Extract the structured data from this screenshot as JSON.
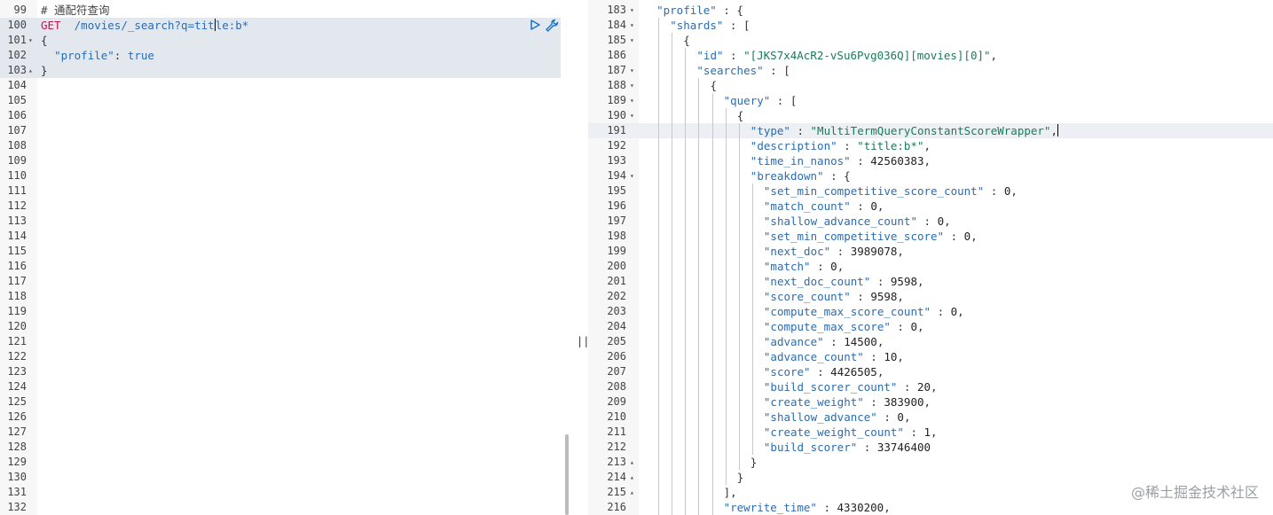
{
  "left_editor": {
    "lines": [
      {
        "no": "99",
        "fold": "",
        "tokens": [
          [
            "c",
            "# 通配符查询"
          ]
        ]
      },
      {
        "no": "100",
        "fold": "",
        "hl": "req",
        "tokens": [
          [
            "m",
            "GET"
          ],
          [
            "p",
            "  "
          ],
          [
            "u",
            "/movies/_search?q=tit"
          ],
          [
            "caret",
            ""
          ],
          [
            "u",
            "le:b*"
          ]
        ]
      },
      {
        "no": "101",
        "fold": "▾",
        "hl": "req",
        "tokens": [
          [
            "p",
            "{"
          ]
        ]
      },
      {
        "no": "102",
        "fold": "",
        "hl": "req",
        "tokens": [
          [
            "p",
            "  "
          ],
          [
            "k",
            "\"profile\""
          ],
          [
            "p",
            ": "
          ],
          [
            "b",
            "true"
          ]
        ]
      },
      {
        "no": "103",
        "fold": "▴",
        "hl": "req",
        "tokens": [
          [
            "p",
            "}"
          ]
        ]
      },
      {
        "no": "104",
        "fold": "",
        "tokens": []
      },
      {
        "no": "105",
        "fold": "",
        "tokens": []
      },
      {
        "no": "106",
        "fold": "",
        "tokens": []
      },
      {
        "no": "107",
        "fold": "",
        "tokens": []
      },
      {
        "no": "108",
        "fold": "",
        "tokens": []
      },
      {
        "no": "109",
        "fold": "",
        "tokens": []
      },
      {
        "no": "110",
        "fold": "",
        "tokens": []
      },
      {
        "no": "111",
        "fold": "",
        "tokens": []
      },
      {
        "no": "112",
        "fold": "",
        "tokens": []
      },
      {
        "no": "113",
        "fold": "",
        "tokens": []
      },
      {
        "no": "114",
        "fold": "",
        "tokens": []
      },
      {
        "no": "115",
        "fold": "",
        "tokens": []
      },
      {
        "no": "116",
        "fold": "",
        "tokens": []
      },
      {
        "no": "117",
        "fold": "",
        "tokens": []
      },
      {
        "no": "118",
        "fold": "",
        "tokens": []
      },
      {
        "no": "119",
        "fold": "",
        "tokens": []
      },
      {
        "no": "120",
        "fold": "",
        "tokens": []
      },
      {
        "no": "121",
        "fold": "",
        "tokens": []
      },
      {
        "no": "122",
        "fold": "",
        "tokens": []
      },
      {
        "no": "123",
        "fold": "",
        "tokens": []
      },
      {
        "no": "124",
        "fold": "",
        "tokens": []
      },
      {
        "no": "125",
        "fold": "",
        "tokens": []
      },
      {
        "no": "126",
        "fold": "",
        "tokens": []
      },
      {
        "no": "127",
        "fold": "",
        "tokens": []
      },
      {
        "no": "128",
        "fold": "",
        "tokens": []
      },
      {
        "no": "129",
        "fold": "",
        "tokens": []
      },
      {
        "no": "130",
        "fold": "",
        "tokens": []
      },
      {
        "no": "131",
        "fold": "",
        "tokens": []
      },
      {
        "no": "132",
        "fold": "",
        "tokens": []
      }
    ]
  },
  "right_editor": {
    "lines": [
      {
        "no": "183",
        "fold": "▾",
        "indent": 1,
        "tokens": [
          [
            "k",
            "\"profile\""
          ],
          [
            "p",
            " : {"
          ]
        ]
      },
      {
        "no": "184",
        "fold": "▾",
        "indent": 2,
        "tokens": [
          [
            "k",
            "\"shards\""
          ],
          [
            "p",
            " : ["
          ]
        ]
      },
      {
        "no": "185",
        "fold": "▾",
        "indent": 3,
        "tokens": [
          [
            "p",
            "{"
          ]
        ]
      },
      {
        "no": "186",
        "fold": "",
        "indent": 4,
        "tokens": [
          [
            "k",
            "\"id\""
          ],
          [
            "p",
            " : "
          ],
          [
            "s",
            "\"[JKS7x4AcR2-vSu6Pvg036Q][movies][0]\""
          ],
          [
            "p",
            ","
          ]
        ]
      },
      {
        "no": "187",
        "fold": "▾",
        "indent": 4,
        "tokens": [
          [
            "k",
            "\"searches\""
          ],
          [
            "p",
            " : ["
          ]
        ]
      },
      {
        "no": "188",
        "fold": "▾",
        "indent": 5,
        "tokens": [
          [
            "p",
            "{"
          ]
        ]
      },
      {
        "no": "189",
        "fold": "▾",
        "indent": 6,
        "tokens": [
          [
            "k",
            "\"query\""
          ],
          [
            "p",
            " : ["
          ]
        ]
      },
      {
        "no": "190",
        "fold": "▾",
        "indent": 7,
        "tokens": [
          [
            "p",
            "{"
          ]
        ]
      },
      {
        "no": "191",
        "fold": "",
        "indent": 8,
        "hl": "cur",
        "tokens": [
          [
            "k",
            "\"type\""
          ],
          [
            "p",
            " : "
          ],
          [
            "s",
            "\"MultiTermQueryConstantScoreWrapper\""
          ],
          [
            "p",
            ","
          ],
          [
            "caret",
            ""
          ]
        ]
      },
      {
        "no": "192",
        "fold": "",
        "indent": 8,
        "tokens": [
          [
            "k",
            "\"description\""
          ],
          [
            "p",
            " : "
          ],
          [
            "s",
            "\"title:b*\""
          ],
          [
            "p",
            ","
          ]
        ]
      },
      {
        "no": "193",
        "fold": "",
        "indent": 8,
        "tokens": [
          [
            "k",
            "\"time_in_nanos\""
          ],
          [
            "p",
            " : "
          ],
          [
            "n",
            "42560383"
          ],
          [
            "p",
            ","
          ]
        ]
      },
      {
        "no": "194",
        "fold": "▾",
        "indent": 8,
        "tokens": [
          [
            "k",
            "\"breakdown\""
          ],
          [
            "p",
            " : {"
          ]
        ]
      },
      {
        "no": "195",
        "fold": "",
        "indent": 9,
        "tokens": [
          [
            "k",
            "\"set_min_competitive_score_count\""
          ],
          [
            "p",
            " : "
          ],
          [
            "n",
            "0"
          ],
          [
            "p",
            ","
          ]
        ]
      },
      {
        "no": "196",
        "fold": "",
        "indent": 9,
        "tokens": [
          [
            "k",
            "\"match_count\""
          ],
          [
            "p",
            " : "
          ],
          [
            "n",
            "0"
          ],
          [
            "p",
            ","
          ]
        ]
      },
      {
        "no": "197",
        "fold": "",
        "indent": 9,
        "tokens": [
          [
            "k",
            "\"shallow_advance_count\""
          ],
          [
            "p",
            " : "
          ],
          [
            "n",
            "0"
          ],
          [
            "p",
            ","
          ]
        ]
      },
      {
        "no": "198",
        "fold": "",
        "indent": 9,
        "tokens": [
          [
            "k",
            "\"set_min_competitive_score\""
          ],
          [
            "p",
            " : "
          ],
          [
            "n",
            "0"
          ],
          [
            "p",
            ","
          ]
        ]
      },
      {
        "no": "199",
        "fold": "",
        "indent": 9,
        "tokens": [
          [
            "k",
            "\"next_doc\""
          ],
          [
            "p",
            " : "
          ],
          [
            "n",
            "3989078"
          ],
          [
            "p",
            ","
          ]
        ]
      },
      {
        "no": "200",
        "fold": "",
        "indent": 9,
        "tokens": [
          [
            "k",
            "\"match\""
          ],
          [
            "p",
            " : "
          ],
          [
            "n",
            "0"
          ],
          [
            "p",
            ","
          ]
        ]
      },
      {
        "no": "201",
        "fold": "",
        "indent": 9,
        "tokens": [
          [
            "k",
            "\"next_doc_count\""
          ],
          [
            "p",
            " : "
          ],
          [
            "n",
            "9598"
          ],
          [
            "p",
            ","
          ]
        ]
      },
      {
        "no": "202",
        "fold": "",
        "indent": 9,
        "tokens": [
          [
            "k",
            "\"score_count\""
          ],
          [
            "p",
            " : "
          ],
          [
            "n",
            "9598"
          ],
          [
            "p",
            ","
          ]
        ]
      },
      {
        "no": "203",
        "fold": "",
        "indent": 9,
        "tokens": [
          [
            "k",
            "\"compute_max_score_count\""
          ],
          [
            "p",
            " : "
          ],
          [
            "n",
            "0"
          ],
          [
            "p",
            ","
          ]
        ]
      },
      {
        "no": "204",
        "fold": "",
        "indent": 9,
        "tokens": [
          [
            "k",
            "\"compute_max_score\""
          ],
          [
            "p",
            " : "
          ],
          [
            "n",
            "0"
          ],
          [
            "p",
            ","
          ]
        ]
      },
      {
        "no": "205",
        "fold": "",
        "indent": 9,
        "tokens": [
          [
            "k",
            "\"advance\""
          ],
          [
            "p",
            " : "
          ],
          [
            "n",
            "14500"
          ],
          [
            "p",
            ","
          ]
        ]
      },
      {
        "no": "206",
        "fold": "",
        "indent": 9,
        "tokens": [
          [
            "k",
            "\"advance_count\""
          ],
          [
            "p",
            " : "
          ],
          [
            "n",
            "10"
          ],
          [
            "p",
            ","
          ]
        ]
      },
      {
        "no": "207",
        "fold": "",
        "indent": 9,
        "tokens": [
          [
            "k",
            "\"score\""
          ],
          [
            "p",
            " : "
          ],
          [
            "n",
            "4426505"
          ],
          [
            "p",
            ","
          ]
        ]
      },
      {
        "no": "208",
        "fold": "",
        "indent": 9,
        "tokens": [
          [
            "k",
            "\"build_scorer_count\""
          ],
          [
            "p",
            " : "
          ],
          [
            "n",
            "20"
          ],
          [
            "p",
            ","
          ]
        ]
      },
      {
        "no": "209",
        "fold": "",
        "indent": 9,
        "tokens": [
          [
            "k",
            "\"create_weight\""
          ],
          [
            "p",
            " : "
          ],
          [
            "n",
            "383900"
          ],
          [
            "p",
            ","
          ]
        ]
      },
      {
        "no": "210",
        "fold": "",
        "indent": 9,
        "tokens": [
          [
            "k",
            "\"shallow_advance\""
          ],
          [
            "p",
            " : "
          ],
          [
            "n",
            "0"
          ],
          [
            "p",
            ","
          ]
        ]
      },
      {
        "no": "211",
        "fold": "",
        "indent": 9,
        "tokens": [
          [
            "k",
            "\"create_weight_count\""
          ],
          [
            "p",
            " : "
          ],
          [
            "n",
            "1"
          ],
          [
            "p",
            ","
          ]
        ]
      },
      {
        "no": "212",
        "fold": "",
        "indent": 9,
        "tokens": [
          [
            "k",
            "\"build_scorer\""
          ],
          [
            "p",
            " : "
          ],
          [
            "n",
            "33746400"
          ]
        ]
      },
      {
        "no": "213",
        "fold": "▴",
        "indent": 8,
        "tokens": [
          [
            "p",
            "}"
          ]
        ]
      },
      {
        "no": "214",
        "fold": "▴",
        "indent": 7,
        "tokens": [
          [
            "p",
            "}"
          ]
        ]
      },
      {
        "no": "215",
        "fold": "▴",
        "indent": 6,
        "tokens": [
          [
            "p",
            "],"
          ]
        ]
      },
      {
        "no": "216",
        "fold": "",
        "indent": 6,
        "tokens": [
          [
            "k",
            "\"rewrite_time\""
          ],
          [
            "p",
            " : "
          ],
          [
            "n",
            "4330200"
          ],
          [
            "p",
            ","
          ]
        ]
      }
    ]
  },
  "divider": {
    "grip": "||"
  },
  "watermark": {
    "text": "@稀土掘金技术社区"
  }
}
